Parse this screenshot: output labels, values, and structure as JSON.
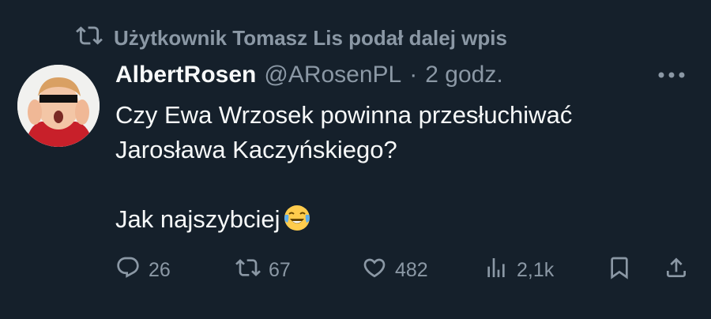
{
  "retweet": {
    "text": "Użytkownik Tomasz Lis podał dalej wpis",
    "icon": "retweet-icon"
  },
  "author": {
    "name": "AlbertRosen",
    "handle": "@ARosenPL",
    "separator": "·",
    "time": "2 godz."
  },
  "tweet": {
    "line1": "Czy Ewa Wrzosek powinna przesłuchiwać",
    "line2": "Jarosława Kaczyńskiego?",
    "line3": "Jak najszybciej",
    "emoji": "face-with-tears-of-joy-emoji"
  },
  "actions": {
    "replies": "26",
    "retweets": "67",
    "likes": "482",
    "views": "2,1k"
  },
  "colors": {
    "background": "#15202b",
    "text": "#f7f9f9",
    "muted": "#8b98a5"
  }
}
